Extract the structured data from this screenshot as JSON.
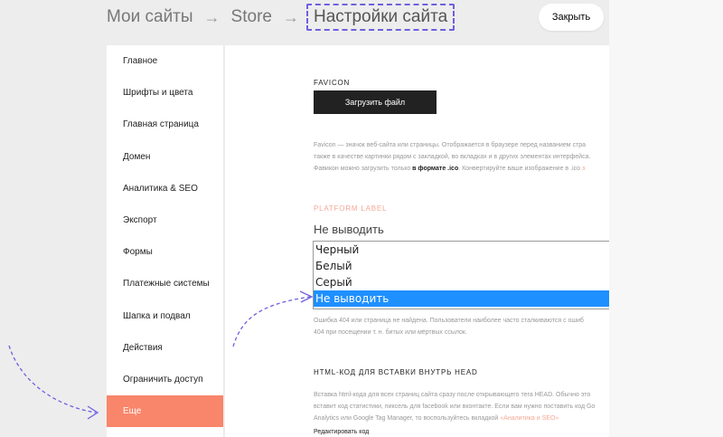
{
  "header": {
    "breadcrumb": [
      "Мои сайты",
      "Store",
      "Настройки сайта"
    ],
    "arrow": "→",
    "close_label": "Закрыть"
  },
  "sidebar": {
    "items": [
      {
        "label": "Главное"
      },
      {
        "label": "Шрифты и цвета"
      },
      {
        "label": "Главная страница"
      },
      {
        "label": "Домен"
      },
      {
        "label": "Аналитика & SEO"
      },
      {
        "label": "Экспорт"
      },
      {
        "label": "Формы"
      },
      {
        "label": "Платежные системы"
      },
      {
        "label": "Шапка и подвал"
      },
      {
        "label": "Действия"
      },
      {
        "label": "Ограничить доступ"
      },
      {
        "label": "Еще",
        "active": true
      }
    ]
  },
  "favicon": {
    "title": "FAVICON",
    "upload_label": "Загрузить файл",
    "desc_line1": "Favicon — значок веб-сайта или страницы. Отображается в браузере перед названием стра",
    "desc_line2": "также в качестве картинки рядом с закладкой, во вкладках и в других элементах интерфейса.",
    "desc_line3_before": "Фавикон можно загрузить только ",
    "desc_line3_bold": "в формате .ico",
    "desc_line3_after": ". Конвертируйте ваше изображение в .ico ",
    "desc_line3_link": "з"
  },
  "platform_label": {
    "title": "PLATFORM LABEL",
    "current_value": "Не выводить",
    "options": [
      {
        "label": "Черный"
      },
      {
        "label": "Белый"
      },
      {
        "label": "Серый"
      },
      {
        "label": "Не выводить",
        "selected": true
      }
    ]
  },
  "page404": {
    "desc_line1": "Ошибка 404 или страница не найдена. Пользователи наиболее часто сталкиваются с ошиб",
    "desc_line2": "404 при посещении т. н. битых или мёртвых ссылок."
  },
  "head_code": {
    "title": "HTML-КОД ДЛЯ ВСТАВКИ ВНУТРЬ HEAD",
    "desc_line1": "Вставка html-кода для всех страниц сайта сразу после открывающего тега HEAD. Обычно это",
    "desc_line2": "вставит код статистики, пиксель для facebook или вконтакте. Если вам нужно поставить код Go",
    "desc_line3_before": "Analytics или Google Tag Manager, то воспользуйтесь вкладкой ",
    "desc_line3_link": "«Аналитика и SEO»",
    "edit_label": "Редактировать код"
  },
  "colors": {
    "accent": "#f9856a",
    "selection": "#1e90ff",
    "annotation": "#6e5fe0"
  }
}
